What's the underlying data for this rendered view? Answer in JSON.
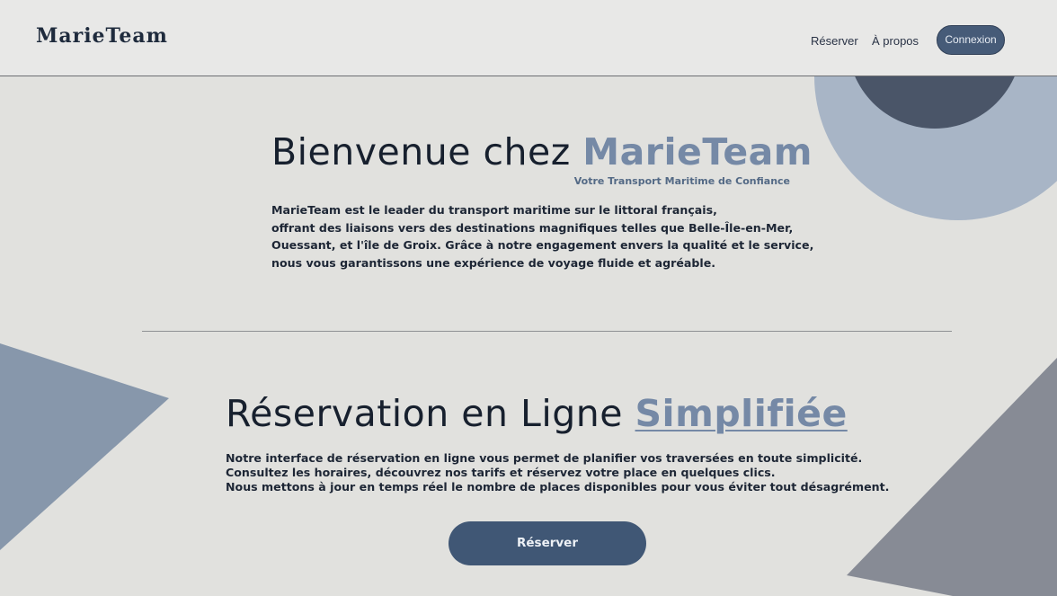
{
  "brand": {
    "logo": "MarieTeam"
  },
  "nav": {
    "reserver": "Réserver",
    "apropos": "À propos",
    "connexion": "Connexion"
  },
  "hero": {
    "title_prefix": "Bienvenue chez ",
    "title_accent": "MarieTeam",
    "tagline": "Votre Transport Maritime de Confiance",
    "paragraph_lines": [
      "MarieTeam est le leader du transport maritime sur le littoral français,",
      "offrant des liaisons vers des destinations magnifiques telles que Belle-Île-en-Mer,",
      "Ouessant, et l'île de Groix. Grâce à notre engagement envers la qualité et le service,",
      "nous vous garantissons une expérience de voyage fluide et agréable."
    ]
  },
  "reservation": {
    "title_prefix": "Réservation en Ligne ",
    "title_accent": "Simplifiée",
    "paragraph_lines": [
      "Notre interface de réservation en ligne vous permet de planifier vos traversées en toute simplicité.",
      "Consultez les horaires, découvrez nos tarifs et réservez votre place en quelques clics.",
      "Nous mettons à jour en temps réel le nombre de places disponibles pour vous éviter tout désagrément."
    ],
    "button_label": "Réserver"
  },
  "colors": {
    "background": "#e1e1de",
    "header_bg": "#e8e8e7",
    "accent": "#7589a6",
    "primary_button": "#405775",
    "circle_light": "#a8b5c6",
    "circle_dark": "#4a5568",
    "triangle_left": "#8797ab",
    "triangle_right": "#878b95"
  }
}
